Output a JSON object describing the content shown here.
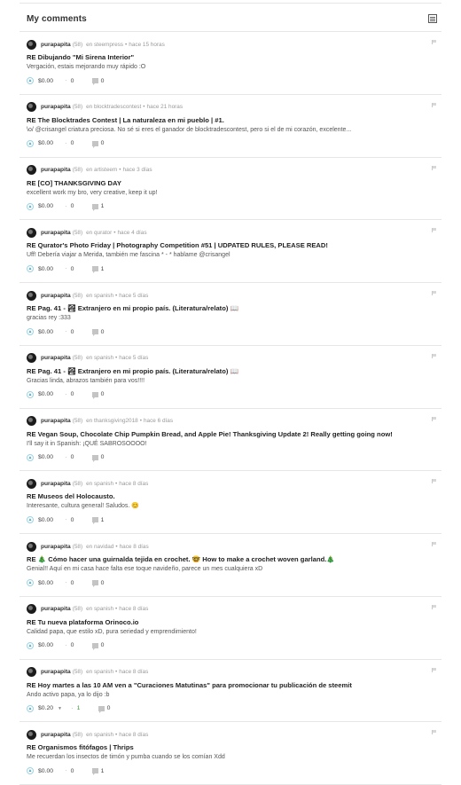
{
  "header": {
    "title": "My comments",
    "view_icon": "list-view-icon"
  },
  "comments": [
    {
      "author": "purapapita",
      "rep": "(58)",
      "community": "en steempress",
      "time": "hace 15 horas",
      "title": "RE Dibujando \"Mi Sirena Interior\"",
      "body": "Vergación, estais mejorando muy rápido :O",
      "payout": "$0.00",
      "votes": "0",
      "replies": "0"
    },
    {
      "author": "purapapita",
      "rep": "(58)",
      "community": "en blocktradescontest",
      "time": "hace 21 horas",
      "title": "RE The Blocktrades Contest | La naturaleza en mi pueblo | #1.",
      "body": "\\o/ @crisangel criatura preciosa. No sé si eres el ganador de blocktradescontest, pero si el de mi corazón, excelente...",
      "payout": "$0.00",
      "votes": "0",
      "replies": "0"
    },
    {
      "author": "purapapita",
      "rep": "(58)",
      "community": "en artisteem",
      "time": "hace 3 días",
      "title": "RE [CO] THANKSGIVING DAY",
      "body": "excellent work my bro, very creative, keep it up!",
      "payout": "$0.00",
      "votes": "0",
      "replies": "1"
    },
    {
      "author": "purapapita",
      "rep": "(58)",
      "community": "en qurator",
      "time": "hace 4 días",
      "title": "RE Qurator's Photo Friday | Photography Competition #51 | UDPATED RULES, PLEASE READ!",
      "body": "Uff! Debería viajar a Merida, también me fascina * - * hablame @crisangel",
      "payout": "$0.00",
      "votes": "0",
      "replies": "1"
    },
    {
      "author": "purapapita",
      "rep": "(58)",
      "community": "en spanish",
      "time": "hace 5 días",
      "title": "RE Pag. 41 - 🏞 Extranjero en mi propio país. (Literatura/relato) 📖",
      "body": "gracias rey :333",
      "payout": "$0.00",
      "votes": "0",
      "replies": "0"
    },
    {
      "author": "purapapita",
      "rep": "(58)",
      "community": "en spanish",
      "time": "hace 5 días",
      "title": "RE Pag. 41 - 🏞 Extranjero en mi propio país. (Literatura/relato) 📖",
      "body": "Gracias linda, abrazos también para vos!!!!",
      "payout": "$0.00",
      "votes": "0",
      "replies": "0"
    },
    {
      "author": "purapapita",
      "rep": "(58)",
      "community": "en thanksgiving2018",
      "time": "hace 6 días",
      "title": "RE Vegan Soup, Chocolate Chip Pumpkin Bread, and Apple Pie! Thanksgiving Update 2! Really getting going now!",
      "body": "I'll say it in Spanish: ¡QUÉ SABROSOOOO!",
      "payout": "$0.00",
      "votes": "0",
      "replies": "0"
    },
    {
      "author": "purapapita",
      "rep": "(58)",
      "community": "en spanish",
      "time": "hace 8 días",
      "title": "RE Museos del Holocausto.",
      "body": "Interesante, cultura general! Saludos. 😊",
      "payout": "$0.00",
      "votes": "0",
      "replies": "1"
    },
    {
      "author": "purapapita",
      "rep": "(58)",
      "community": "en navidad",
      "time": "hace 8 días",
      "title": "RE 🎄 Cómo hacer una guirnalda tejida en crochet. 🤓 How to make a crochet woven garland.🎄",
      "body": "Genial!! Aquí en mi casa hace falta ese toque navideño, parece un mes cualquiera xD",
      "payout": "$0.00",
      "votes": "0",
      "replies": "0"
    },
    {
      "author": "purapapita",
      "rep": "(58)",
      "community": "en spanish",
      "time": "hace 8 días",
      "title": "RE Tu nueva plataforma Orinoco.io",
      "body": "Calidad papa, que estilo xD, pura seriedad y emprendimiento!",
      "payout": "$0.00",
      "votes": "0",
      "replies": "0"
    },
    {
      "author": "purapapita",
      "rep": "(58)",
      "community": "en spanish",
      "time": "hace 8 días",
      "title": "RE Hoy martes a las 10 AM ven a \"Curaciones Matutinas\" para promocionar tu publicación de steemit",
      "body": "Ando activo papa, ya lo dijo :b",
      "payout": "$0.20",
      "votes": "1",
      "replies": "0",
      "has_dropdown": true,
      "voted": true
    },
    {
      "author": "purapapita",
      "rep": "(58)",
      "community": "en spanish",
      "time": "hace 8 días",
      "title": "RE Organismos fitófagos | Thrips",
      "body": "Me recuerdan los insectos de timón y pumba cuando se los comían Xdd",
      "payout": "$0.00",
      "votes": "0",
      "replies": "1"
    }
  ]
}
